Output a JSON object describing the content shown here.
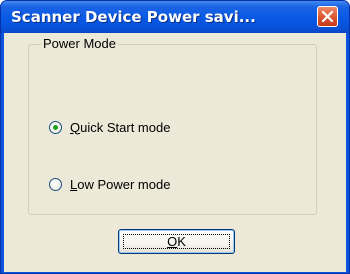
{
  "window": {
    "title": "Scanner Device Power savi...",
    "close_icon": "close-icon"
  },
  "power_mode": {
    "legend": "Power Mode",
    "options": [
      {
        "label": "Quick Start mode",
        "mnemonic": "Q",
        "rest": "uick Start mode",
        "selected": true
      },
      {
        "label": "Low Power mode",
        "mnemonic": "L",
        "rest": "ow Power mode",
        "selected": false
      }
    ]
  },
  "buttons": {
    "ok_label": "OK",
    "ok_mnemonic": "O",
    "ok_rest": "K"
  },
  "colors": {
    "titlebar": "#0a54e0",
    "dialog_face": "#ece9d8",
    "close_button": "#dc5a34",
    "radio_dot": "#21a121"
  }
}
